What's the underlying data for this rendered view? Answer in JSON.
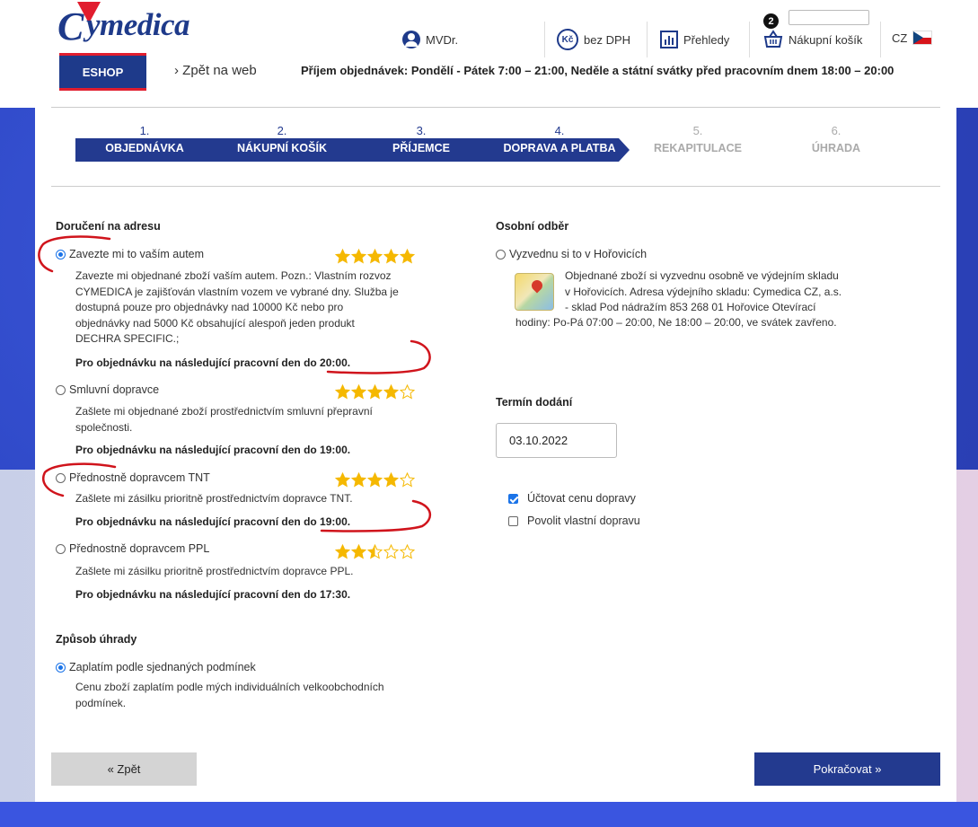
{
  "header": {
    "logo_text": "ymedica",
    "logo_initial": "C",
    "user_label": "MVDr.",
    "price_mode": "bez DPH",
    "price_icon_text": "Kč",
    "reports_label": "Přehledy",
    "cart_label": "Nákupní košík",
    "cart_count": "2",
    "language": "CZ",
    "eshop_label": "ESHOP",
    "back_to_web": "› Zpět na web",
    "notice": "Příjem objednávek: Pondělí - Pátek 7:00 – 21:00, Neděle a státní svátky před pracovním dnem 18:00 – 20:00"
  },
  "steps": [
    {
      "num": "1.",
      "label": "OBJEDNÁVKA",
      "active": true
    },
    {
      "num": "2.",
      "label": "NÁKUPNÍ KOŠÍK",
      "active": true
    },
    {
      "num": "3.",
      "label": "PŘÍJEMCE",
      "active": true
    },
    {
      "num": "4.",
      "label": "DOPRAVA A PLATBA",
      "active": true
    },
    {
      "num": "5.",
      "label": "REKAPITULACE",
      "active": false
    },
    {
      "num": "6.",
      "label": "ÚHRADA",
      "active": false
    }
  ],
  "delivery": {
    "title": "Doručení na adresu",
    "options": [
      {
        "label": "Zavezte mi to vaším autem",
        "selected": true,
        "rating": 5,
        "desc": [
          "Zavezte mi objednané zboží vaším autem. Pozn.: Vlastním rozvoz",
          "CYMEDICA je zajišťován vlastním vozem ve vybrané dny. Služba je",
          "dostupná pouze pro objednávky nad 10000 Kč nebo pro",
          "objednávky nad 5000 Kč obsahující alespoň jeden produkt",
          "DECHRA SPECIFIC.;"
        ],
        "deadline": "Pro objednávku na následující pracovní den do 20:00."
      },
      {
        "label": "Smluvní dopravce",
        "selected": false,
        "rating": 4,
        "desc": [
          "Zašlete mi objednané zboží prostřednictvím smluvní přepravní",
          "společnosti."
        ],
        "deadline": "Pro objednávku na následující pracovní den do 19:00."
      },
      {
        "label": "Přednostně dopravcem TNT",
        "selected": false,
        "rating": 4,
        "desc": [
          "Zašlete mi zásilku prioritně prostřednictvím dopravce TNT."
        ],
        "deadline": "Pro objednávku na následující pracovní den do 19:00."
      },
      {
        "label": "Přednostně dopravcem PPL",
        "selected": false,
        "rating": 2.5,
        "desc": [
          "Zašlete mi zásilku prioritně prostřednictvím dopravce PPL."
        ],
        "deadline": "Pro objednávku na následující pracovní den do 17:30."
      }
    ]
  },
  "payment": {
    "title": "Způsob úhrady",
    "option_label": "Zaplatím podle sjednaných podmínek",
    "desc": [
      "Cenu zboží zaplatím podle mých individuálních velkoobchodních",
      "podmínek."
    ]
  },
  "pickup": {
    "title": "Osobní odběr",
    "option_label": "Vyzvednu si to v Hořovicích",
    "desc": [
      "Objednané zboží si vyzvednu osobně ve výdejním skladu",
      "v Hořovicích. Adresa výdejního skladu: Cymedica CZ, a.s.",
      "- sklad Pod nádražím 853 268 01 Hořovice Otevírací",
      "hodiny: Po-Pá 07:00 – 20:00, Ne 18:00 – 20:00, ve svátek zavřeno."
    ]
  },
  "delivery_date": {
    "title": "Termín dodání",
    "value": "03.10.2022"
  },
  "checkboxes": [
    {
      "label": "Účtovat cenu dopravy",
      "checked": true
    },
    {
      "label": "Povolit vlastní dopravu",
      "checked": false
    }
  ],
  "buttons": {
    "back": "« Zpět",
    "next": "Pokračovat »"
  },
  "colors": {
    "brand_blue": "#233a8f",
    "brand_red": "#e11d2e",
    "star_gold": "#f5b800",
    "annotation_red": "#d0141c"
  }
}
